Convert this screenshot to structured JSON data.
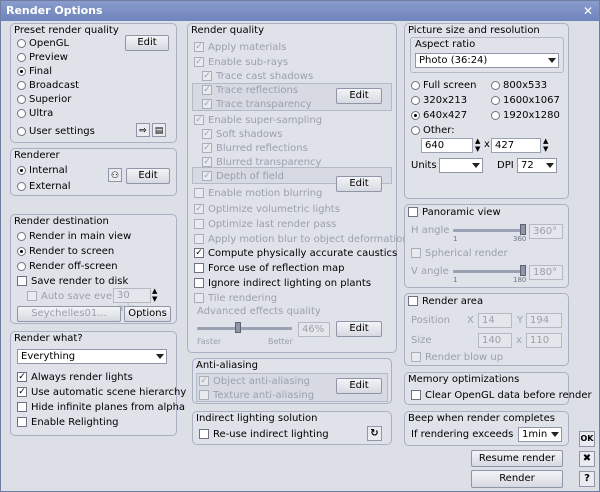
{
  "window": {
    "title": "Render Options"
  },
  "preset": {
    "title": "Preset render quality",
    "options": [
      "OpenGL",
      "Preview",
      "Final",
      "Broadcast",
      "Superior",
      "Ultra",
      "User settings"
    ],
    "selected": "Final",
    "edit_label": "Edit"
  },
  "renderer": {
    "title": "Renderer",
    "options": [
      "Internal",
      "External"
    ],
    "selected": "Internal",
    "edit_label": "Edit"
  },
  "destination": {
    "title": "Render destination",
    "options": [
      "Render in main view",
      "Render to screen",
      "Render off-screen"
    ],
    "selected": "Render to screen",
    "save_to_disk": "Save render to disk",
    "auto_save": "Auto save every",
    "auto_save_value": "30 min",
    "file_label": "Seychelles01...",
    "options_label": "Options"
  },
  "render_what": {
    "title": "Render what?",
    "value": "Everything",
    "checks": [
      {
        "label": "Always render lights",
        "checked": true
      },
      {
        "label": "Use automatic scene hierarchy",
        "checked": true
      },
      {
        "label": "Hide infinite planes from alpha",
        "checked": false
      },
      {
        "label": "Enable Relighting",
        "checked": false
      }
    ]
  },
  "quality": {
    "title": "Render quality",
    "items": [
      "Apply materials",
      "Enable sub-rays",
      "Trace cast shadows",
      "Trace reflections",
      "Trace transparency",
      "Enable super-sampling",
      "Soft shadows",
      "Blurred reflections",
      "Blurred transparency",
      "Depth of field",
      "Enable motion blurring",
      "Optimize volumetric lights",
      "Optimize last render pass",
      "Apply motion blur to object deformation",
      "Compute physically accurate caustics",
      "Force use of reflection map",
      "Ignore indirect lighting on plants",
      "Tile rendering"
    ],
    "edit_label": "Edit",
    "advanced_title": "Advanced effects quality",
    "advanced_value": "46%",
    "faster": "Faster",
    "better": "Better"
  },
  "antialiasing": {
    "title": "Anti-aliasing",
    "object": "Object anti-aliasing",
    "texture": "Texture anti-aliasing",
    "edit_label": "Edit"
  },
  "indirect": {
    "title": "Indirect lighting solution",
    "reuse": "Re-use indirect lighting"
  },
  "picture": {
    "title": "Picture size and resolution",
    "aspect_title": "Aspect ratio",
    "aspect_value": "Photo (36:24)",
    "sizes": [
      "Full screen",
      "800x533",
      "320x213",
      "1600x1067",
      "640x427",
      "1920x1280",
      "Other:"
    ],
    "selected": "640x427",
    "width": "640",
    "height": "427",
    "x": "x",
    "units": "Units",
    "dpi": "DPI",
    "dpi_value": "72"
  },
  "panoramic": {
    "title": "Panoramic view",
    "h_angle": "H angle",
    "h_value": "360°",
    "h_min": "1",
    "h_max": "360",
    "spherical": "Spherical render",
    "v_angle": "V angle",
    "v_value": "180°",
    "v_min": "1",
    "v_max": "180"
  },
  "area": {
    "title": "Render area",
    "position": "Position",
    "size": "Size",
    "x": "X",
    "y": "Y",
    "x_value": "14",
    "y_value": "194",
    "w_value": "140",
    "h_value": "110",
    "blowup": "Render blow up"
  },
  "memory": {
    "title": "Memory optimizations",
    "clear": "Clear OpenGL data before render"
  },
  "beep": {
    "title": "Beep when render completes",
    "if_exceeds": "If rendering exceeds",
    "value": "1min"
  },
  "actions": {
    "resume": "Resume render",
    "render": "Render"
  },
  "side": {
    "ok": "OK",
    "cancel": "✖",
    "help": "?"
  }
}
